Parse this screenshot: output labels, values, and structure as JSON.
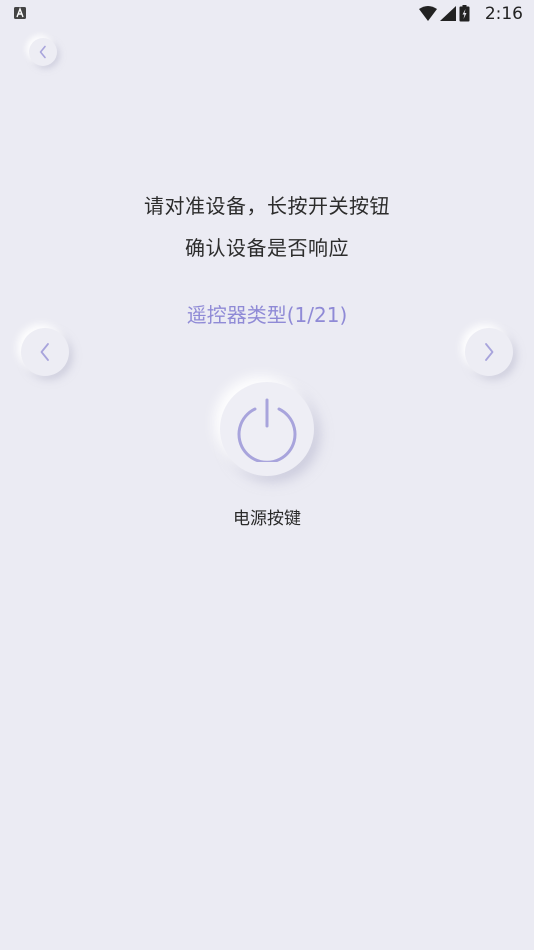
{
  "status_bar": {
    "time": "2:16",
    "icons": [
      "app-notification-icon",
      "wifi-icon",
      "cell-signal-icon",
      "battery-charging-icon"
    ]
  },
  "header": {
    "back_icon": "chevron-left-icon"
  },
  "instructions": {
    "line1": "请对准设备，长按开关按钮",
    "line2": "确认设备是否响应"
  },
  "remote_type": {
    "label": "遥控器类型(1/21)"
  },
  "navigation": {
    "prev_icon": "chevron-left-icon",
    "next_icon": "chevron-right-icon"
  },
  "power_key": {
    "icon": "power-icon",
    "label": "电源按键"
  },
  "colors": {
    "background": "#ebebf3",
    "accent": "#8f8ad6",
    "icon_stroke": "#a8a4dc"
  }
}
